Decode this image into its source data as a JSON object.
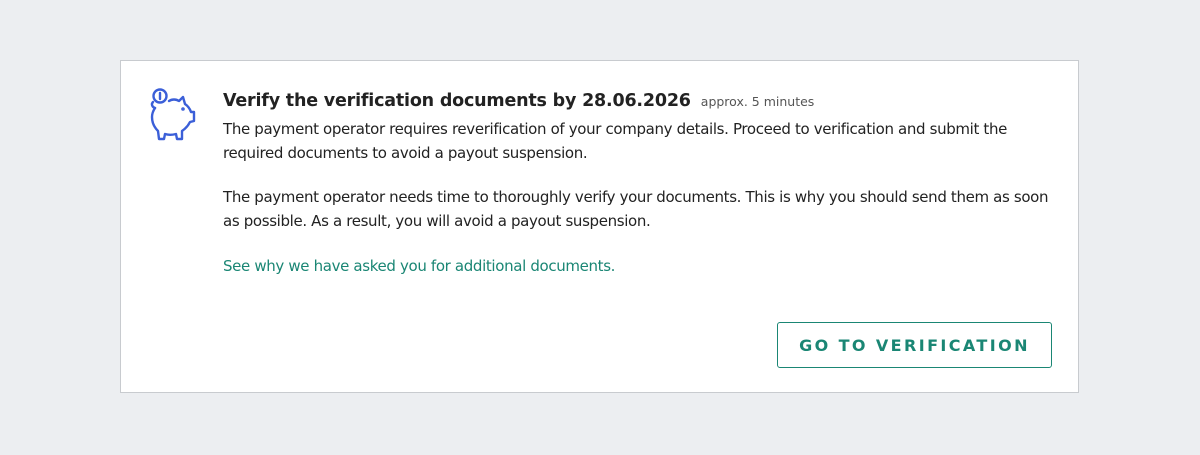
{
  "task": {
    "title": "Verify the verification documents by 28.06.2026",
    "duration": "approx. 5 minutes",
    "paragraph1": "The payment operator requires reverification of your company details. Proceed to verification and submit the required documents to avoid a payout suspension.",
    "paragraph2": "The payment operator needs time to thoroughly verify your documents. This is why you should send them as soon as possible. As a result, you will avoid a payout suspension.",
    "link_text": "See why we have asked you for additional documents.",
    "button_label": "GO TO VERIFICATION",
    "icon": "piggy-bank-icon"
  },
  "colors": {
    "background": "#eceef1",
    "accent": "#1a8674",
    "icon": "#3b5fd8"
  }
}
